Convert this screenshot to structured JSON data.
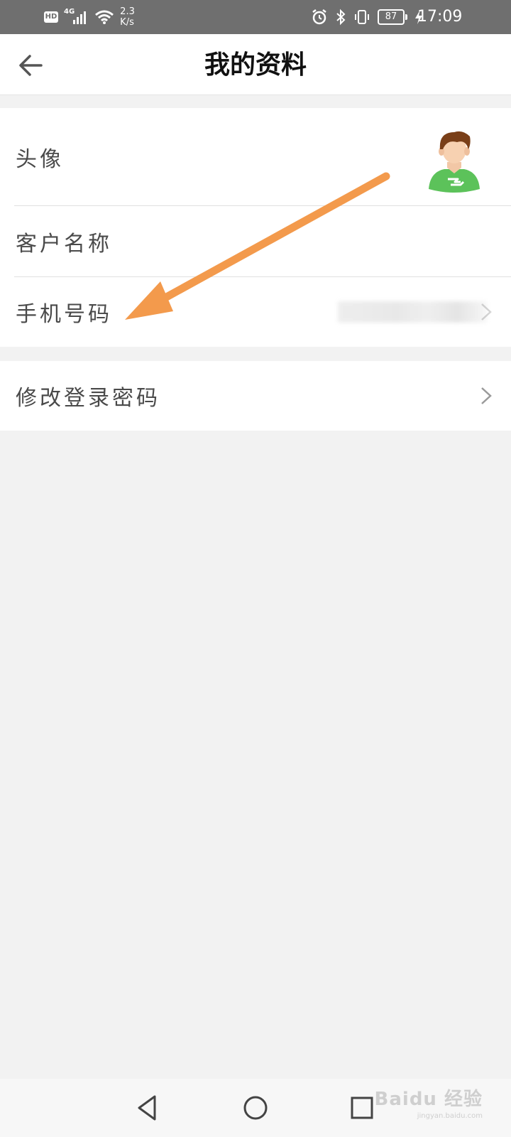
{
  "status_bar": {
    "hd_label": "HD",
    "network_type": "4G",
    "speed_value": "2.3",
    "speed_unit": "K/s",
    "battery": "87",
    "time": "17:09"
  },
  "header": {
    "title": "我的资料"
  },
  "profile": {
    "avatar_label": "头像",
    "name_label": "客户名称",
    "phone_label": "手机号码",
    "password_label": "修改登录密码"
  },
  "watermark": {
    "main": "Baidu 经验",
    "sub": "jingyan.baidu.com"
  },
  "colors": {
    "status_bar_bg": "#6f6f6f",
    "annotation_arrow": "#f39a4c",
    "avatar_shirt": "#5cc25a",
    "page_bg": "#f2f2f2"
  },
  "icons": {
    "back": "arrow-left-icon",
    "chevron": "chevron-right-icon",
    "nav_back": "triangle-back-icon",
    "nav_home": "circle-home-icon",
    "nav_recents": "square-recents-icon"
  }
}
